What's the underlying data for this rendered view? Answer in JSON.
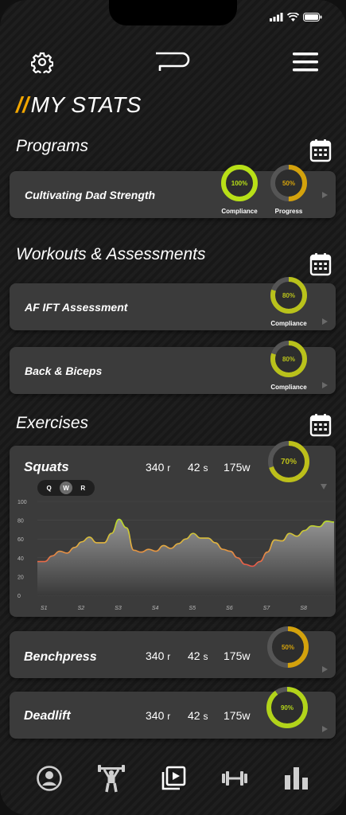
{
  "header": {
    "title_slashes": "//",
    "title": "MY STATS"
  },
  "programs": {
    "title": "Programs",
    "items": [
      {
        "name": "Cultivating Dad Strength",
        "compliance": {
          "value": 100,
          "text": "100%",
          "label": "Compliance",
          "color": "#b8e017"
        },
        "progress": {
          "value": 50,
          "text": "50%",
          "label": "Progress",
          "color": "#d4a20c"
        }
      }
    ]
  },
  "workouts": {
    "title": "Workouts & Assessments",
    "items": [
      {
        "name": "AF IFT Assessment",
        "compliance": {
          "value": 80,
          "text": "80%",
          "label": "Compliance",
          "color": "#b9c21b"
        }
      },
      {
        "name": "Back & Biceps",
        "compliance": {
          "value": 80,
          "text": "80%",
          "label": "Compliance",
          "color": "#b9c21b"
        }
      }
    ]
  },
  "exercises": {
    "title": "Exercises",
    "items": [
      {
        "name": "Squats",
        "reps": "340",
        "reps_unit": "r",
        "time": "42",
        "time_unit": "s",
        "weight": "175w",
        "ring": {
          "value": 70,
          "text": "70%",
          "color": "#bcbf1a"
        }
      },
      {
        "name": "Benchpress",
        "reps": "340",
        "reps_unit": "r",
        "time": "42",
        "time_unit": "s",
        "weight": "175w",
        "ring": {
          "value": 50,
          "text": "50%",
          "color": "#d4a20c"
        }
      },
      {
        "name": "Deadlift",
        "reps": "340",
        "reps_unit": "r",
        "time": "42",
        "time_unit": "s",
        "weight": "175w",
        "ring": {
          "value": 90,
          "text": "90%",
          "color": "#b2d41a"
        }
      }
    ],
    "period_options": [
      "Q",
      "W",
      "R"
    ],
    "period_selected": "W"
  },
  "chart_data": {
    "type": "area",
    "x_labels": [
      "S1",
      "S2",
      "S3",
      "S4",
      "S5",
      "S6",
      "S7",
      "S8"
    ],
    "y_ticks": [
      0,
      20,
      40,
      60,
      80,
      100
    ],
    "ylim": [
      0,
      100
    ],
    "title": "",
    "xlabel": "",
    "ylabel": "",
    "series": [
      {
        "x": [
          0,
          0.2,
          0.4,
          0.6,
          0.8,
          1.0,
          1.2,
          1.4,
          1.6,
          1.8,
          2.0,
          2.2,
          2.4,
          2.6,
          2.8,
          3.0,
          3.2,
          3.4,
          3.6,
          3.8,
          4.0,
          4.2,
          4.4,
          4.6,
          4.8,
          5.0,
          5.2,
          5.4,
          5.6,
          5.8,
          6.0,
          6.2,
          6.4,
          6.6,
          6.8,
          7.0,
          7.2,
          7.4,
          7.6,
          7.8,
          8.0
        ],
        "y": [
          36,
          36,
          42,
          47,
          45,
          51,
          57,
          62,
          56,
          56,
          66,
          81,
          72,
          48,
          46,
          49,
          47,
          53,
          50,
          55,
          60,
          66,
          61,
          61,
          56,
          49,
          47,
          40,
          33,
          31,
          36,
          46,
          59,
          58,
          66,
          63,
          69,
          74,
          73,
          79,
          78
        ]
      }
    ]
  },
  "colors": {
    "accent": "#f2a600",
    "card_bg": "#3b3b3b",
    "line_low": "#e8534a",
    "line_mid": "#e3b340",
    "line_high": "#b7dd2a"
  },
  "nav": {
    "items": [
      {
        "icon": "profile-icon"
      },
      {
        "icon": "weightlifter-icon"
      },
      {
        "icon": "video-library-icon"
      },
      {
        "icon": "dumbbell-icon"
      },
      {
        "icon": "bar-chart-icon"
      }
    ]
  }
}
